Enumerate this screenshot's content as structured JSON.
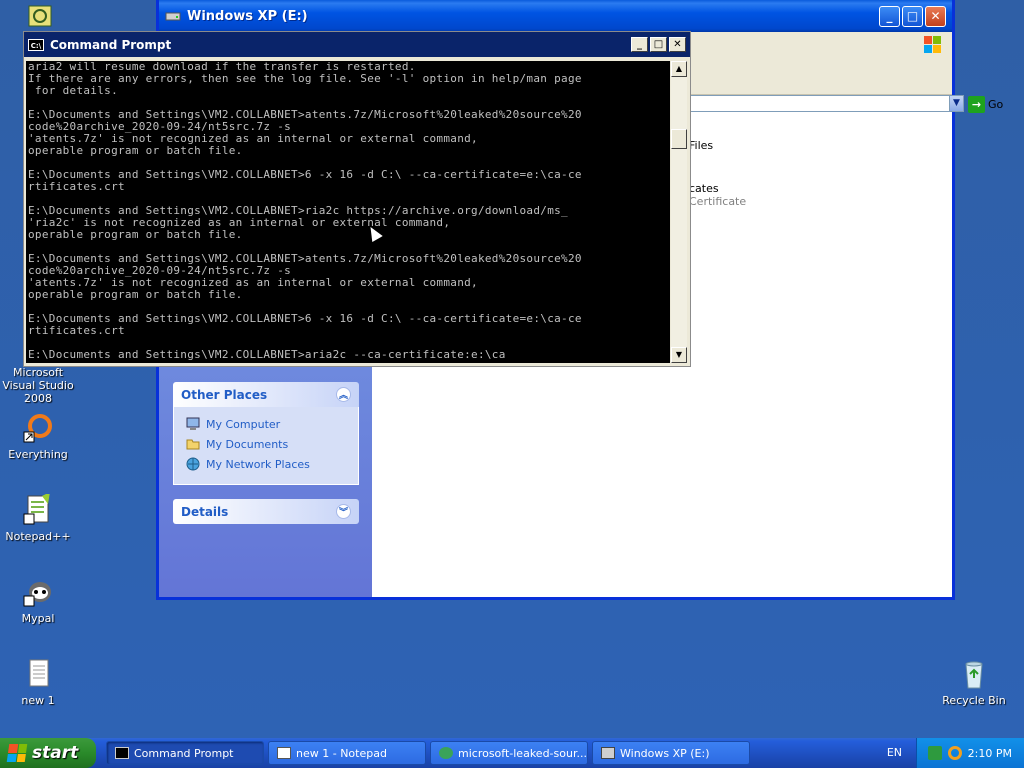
{
  "desktop": {
    "icons": [
      {
        "label": "Microsoft Visual Studio 2008"
      },
      {
        "label": "Everything"
      },
      {
        "label": "Notepad++"
      },
      {
        "label": "Mypal"
      },
      {
        "label": "new 1"
      },
      {
        "label": "Recycle Bin"
      }
    ]
  },
  "explorer": {
    "title": "Windows XP (E:)",
    "go_label": "Go",
    "other_places": {
      "title": "Other Places",
      "links": [
        "My Computer",
        "My Documents",
        "My Network Places"
      ]
    },
    "details": {
      "title": "Details"
    },
    "files": {
      "item1": "Files",
      "item2_name": "cates",
      "item2_sub": "Certificate"
    }
  },
  "cmd": {
    "title": "Command Prompt",
    "lines": "aria2 will resume download if the transfer is restarted.\nIf there are any errors, then see the log file. See '-l' option in help/man page\n for details.\n\nE:\\Documents and Settings\\VM2.COLLABNET>atents.7z/Microsoft%20leaked%20source%20\ncode%20archive_2020-09-24/nt5src.7z -s\n'atents.7z' is not recognized as an internal or external command,\noperable program or batch file.\n\nE:\\Documents and Settings\\VM2.COLLABNET>6 -x 16 -d C:\\ --ca-certificate=e:\\ca-ce\nrtificates.crt\n\nE:\\Documents and Settings\\VM2.COLLABNET>ria2c https://archive.org/download/ms_\n'ria2c' is not recognized as an internal or external command,\noperable program or batch file.\n\nE:\\Documents and Settings\\VM2.COLLABNET>atents.7z/Microsoft%20leaked%20source%20\ncode%20archive_2020-09-24/nt5src.7z -s\n'atents.7z' is not recognized as an internal or external command,\noperable program or batch file.\n\nE:\\Documents and Settings\\VM2.COLLABNET>6 -x 16 -d C:\\ --ca-certificate=e:\\ca-ce\nrtificates.crt\n\nE:\\Documents and Settings\\VM2.COLLABNET>aria2c --ca-certificate:e:\\ca"
  },
  "taskbar": {
    "start_label": "start",
    "buttons": [
      {
        "label": "Command Prompt"
      },
      {
        "label": "new 1 - Notepad"
      },
      {
        "label": "microsoft-leaked-sour..."
      },
      {
        "label": "Windows XP (E:)"
      }
    ],
    "lang": "EN",
    "clock": "2:10 PM"
  }
}
